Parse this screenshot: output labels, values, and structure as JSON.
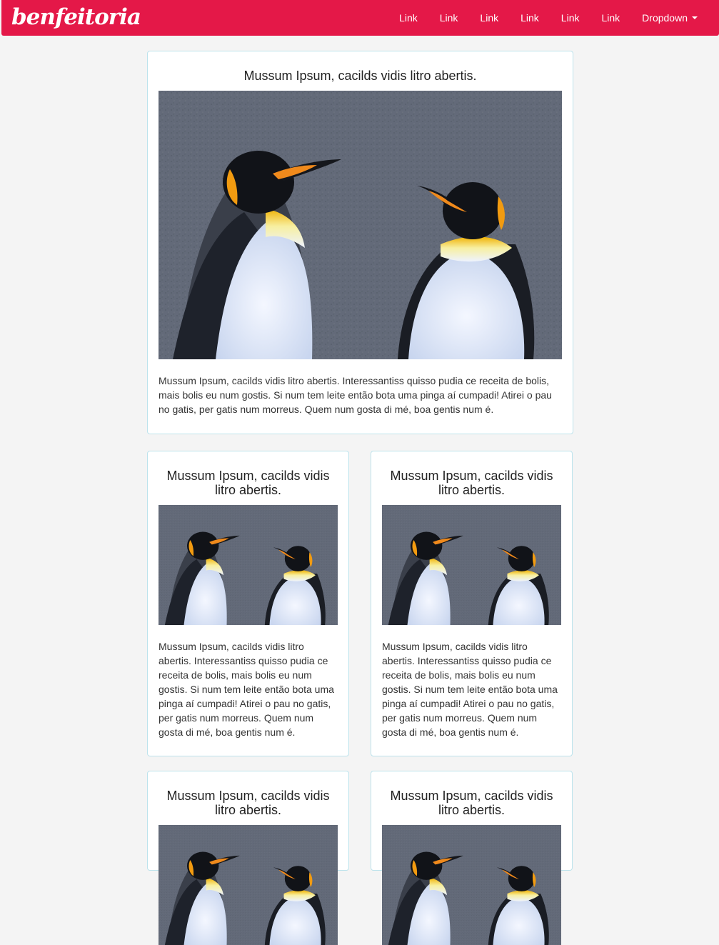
{
  "navbar": {
    "brand": "benfeitoria",
    "links": [
      "Link",
      "Link",
      "Link",
      "Link",
      "Link",
      "Link"
    ],
    "dropdown": "Dropdown",
    "color": "#e41848"
  },
  "cards": [
    {
      "title": "Mussum Ipsum, cacilds vidis litro abertis.",
      "image": "king-penguins-photo",
      "text": "Mussum Ipsum, cacilds vidis litro abertis. Interessantiss quisso pudia ce receita de bolis, mais bolis eu num gostis. Si num tem leite então bota uma pinga aí cumpadi! Atirei o pau no gatis, per gatis num morreus. Quem num gosta di mé, boa gentis num é."
    },
    {
      "title": "Mussum Ipsum, cacilds vidis litro abertis.",
      "image": "king-penguins-photo",
      "text": "Mussum Ipsum, cacilds vidis litro abertis. Interessantiss quisso pudia ce receita de bolis, mais bolis eu num gostis. Si num tem leite então bota uma pinga aí cumpadi! Atirei o pau no gatis, per gatis num morreus. Quem num gosta di mé, boa gentis num é."
    },
    {
      "title": "Mussum Ipsum, cacilds vidis litro abertis.",
      "image": "king-penguins-photo",
      "text": "Mussum Ipsum, cacilds vidis litro abertis. Interessantiss quisso pudia ce receita de bolis, mais bolis eu num gostis. Si num tem leite então bota uma pinga aí cumpadi! Atirei o pau no gatis, per gatis num morreus. Quem num gosta di mé, boa gentis num é."
    },
    {
      "title": "Mussum Ipsum, cacilds vidis litro abertis.",
      "image": "king-penguins-photo",
      "text": ""
    },
    {
      "title": "Mussum Ipsum, cacilds vidis litro abertis.",
      "image": "king-penguins-photo",
      "text": ""
    }
  ]
}
